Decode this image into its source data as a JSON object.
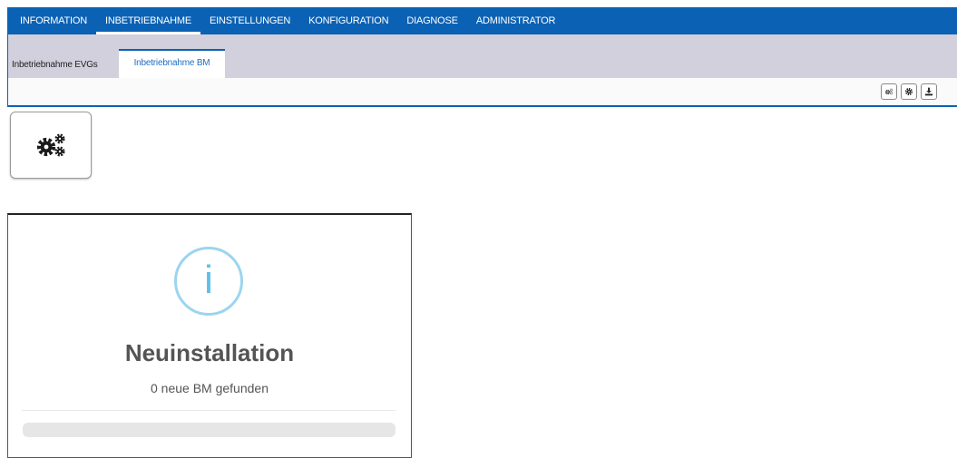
{
  "topnav": {
    "items": [
      {
        "label": "INFORMATION"
      },
      {
        "label": "INBETRIEBNAHME"
      },
      {
        "label": "EINSTELLUNGEN"
      },
      {
        "label": "KONFIGURATION"
      },
      {
        "label": "DIAGNOSE"
      },
      {
        "label": "ADMINISTRATOR"
      }
    ],
    "active": "INBETRIEBNAHME"
  },
  "subtabs": {
    "items": [
      {
        "label": "Inbetriebnahme EVGs"
      },
      {
        "label": "Inbetriebnahme BM"
      }
    ],
    "active": "Inbetriebnahme BM"
  },
  "toolbar": {
    "buttons": [
      {
        "icon": "gears-icon"
      },
      {
        "icon": "gear-icon"
      },
      {
        "icon": "download-icon"
      }
    ]
  },
  "main_button": {
    "icon": "gears-icon"
  },
  "dialog": {
    "icon": "info-icon",
    "icon_glyph": "i",
    "title": "Neuinstallation",
    "text": "0 neue BM gefunden",
    "progress": 0
  },
  "colors": {
    "nav_bg": "#0b62b5",
    "subbar_bg": "#d1d0dc",
    "info_accent": "#9bd5ef"
  }
}
